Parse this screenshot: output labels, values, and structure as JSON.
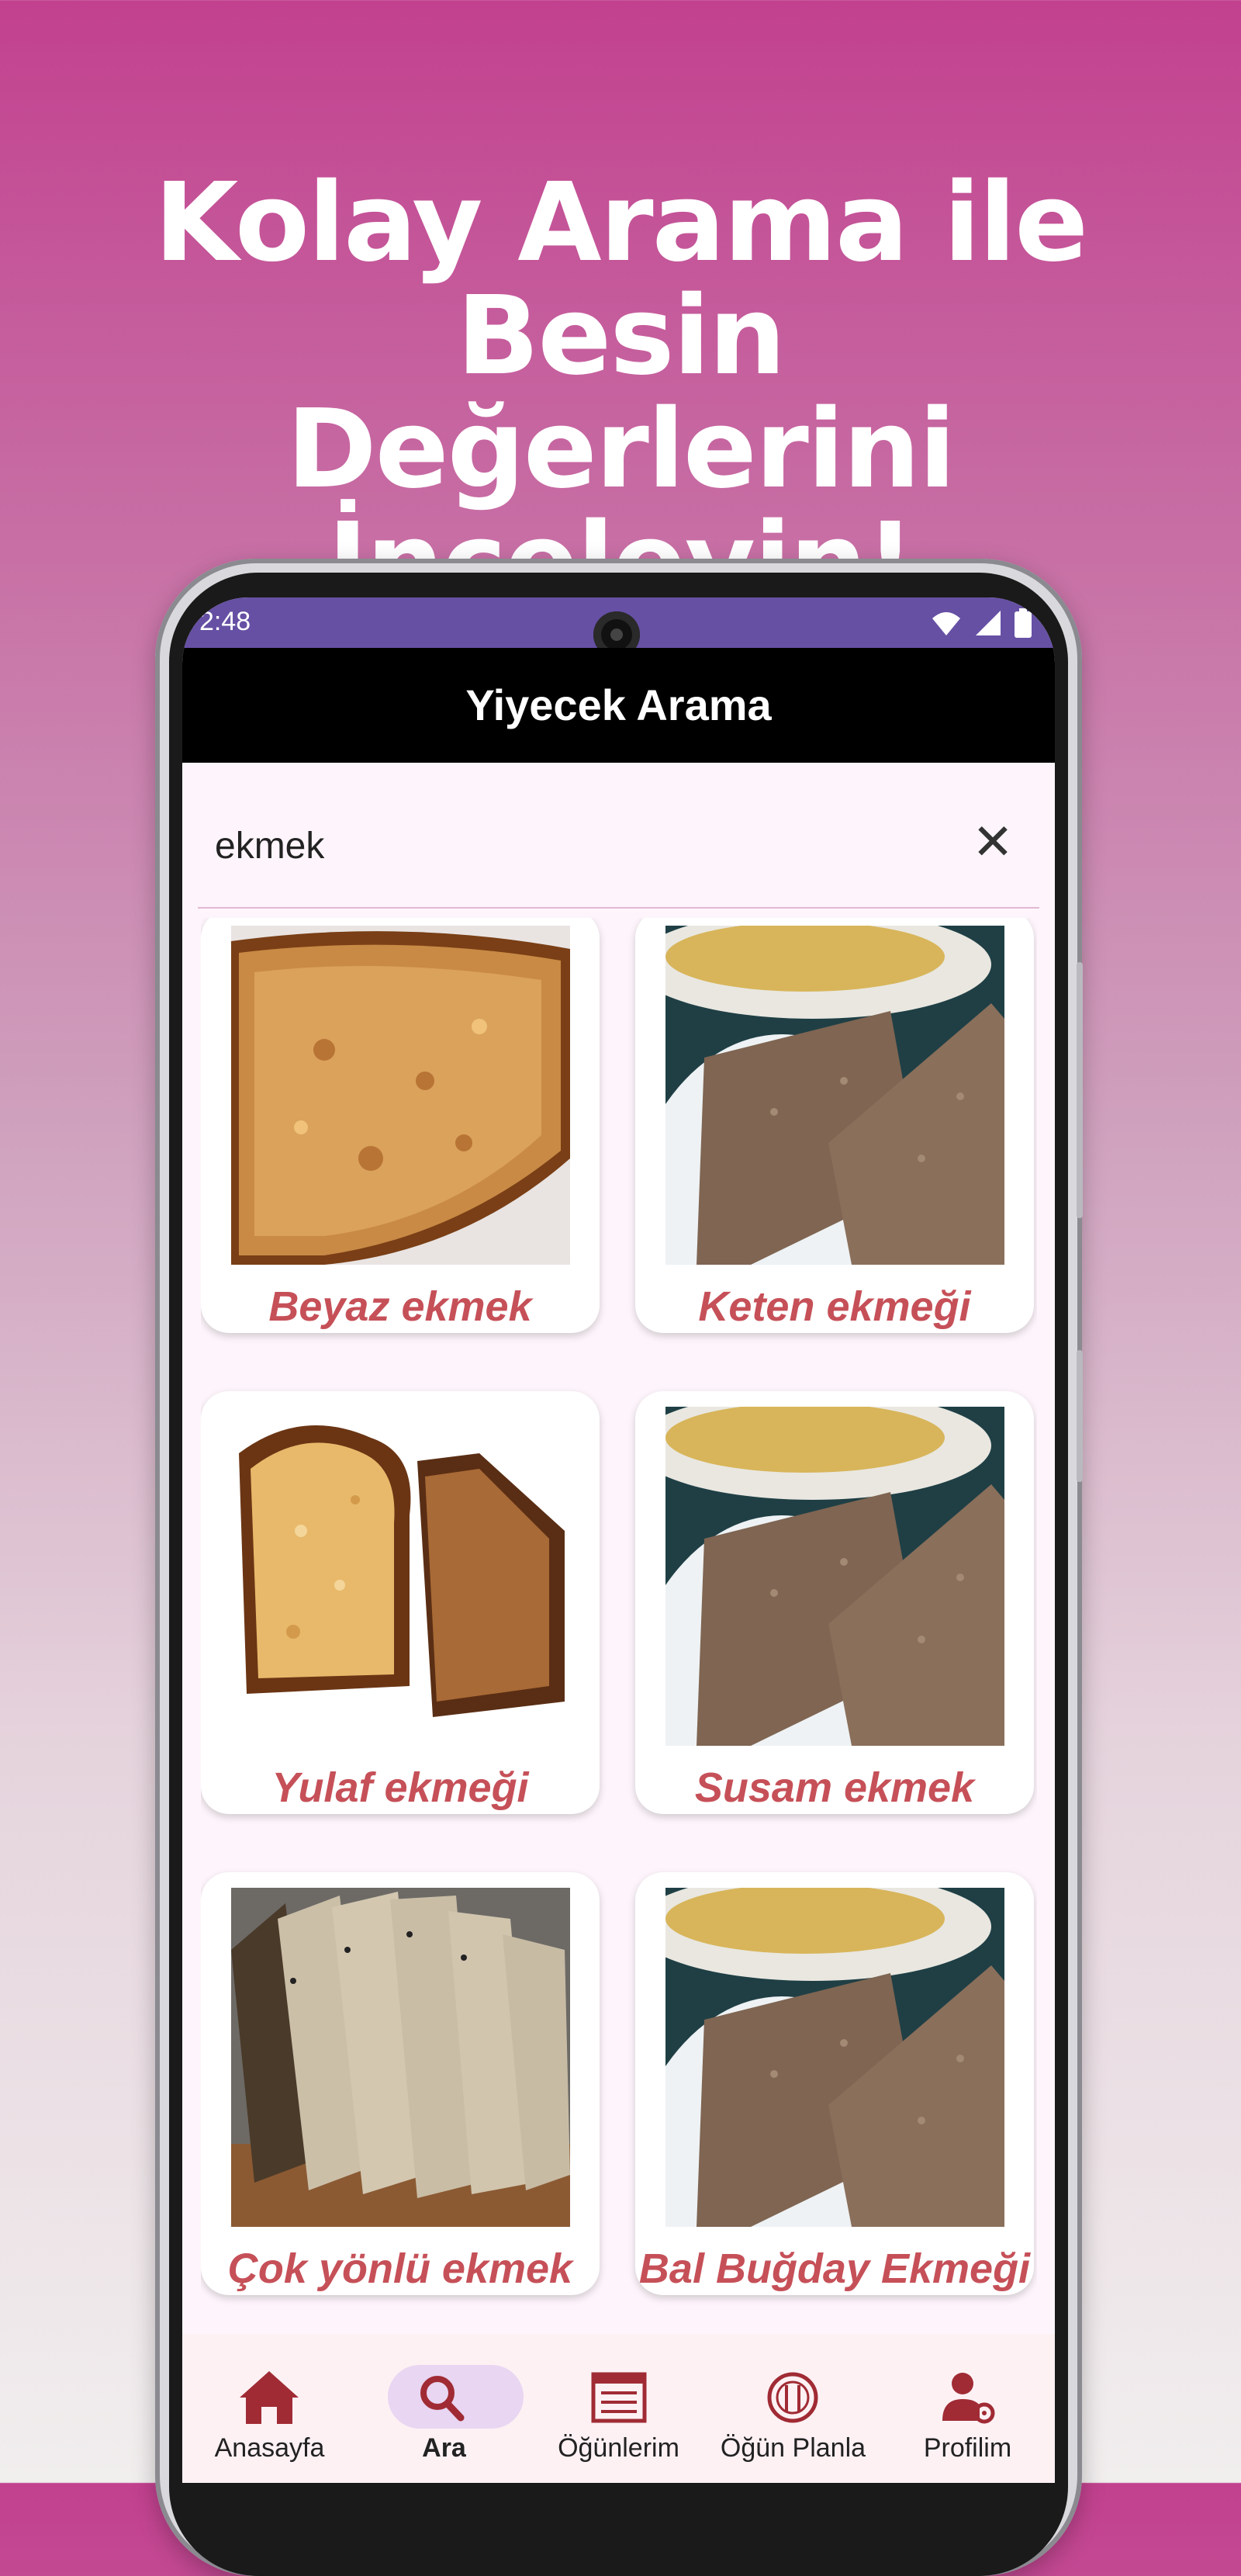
{
  "headline": {
    "line1": "Kolay Arama ile Besin",
    "line2": "Değerlerini İnceleyin!"
  },
  "status_bar": {
    "time": "2:48",
    "icons": [
      "wifi-icon",
      "signal-icon",
      "battery-icon"
    ]
  },
  "app_bar": {
    "title": "Yiyecek Arama"
  },
  "search": {
    "value": "ekmek",
    "clear_icon": "close-icon"
  },
  "results": [
    {
      "label": "Beyaz ekmek",
      "image": "toasted-bread-slice"
    },
    {
      "label": "Keten ekmeği",
      "image": "brown-toast-with-omelette"
    },
    {
      "label": "Yulaf ekmeği",
      "image": "sliced-toasted-loaf"
    },
    {
      "label": "Susam ekmek",
      "image": "brown-toast-with-omelette"
    },
    {
      "label": "Çok yönlü ekmek",
      "image": "sliced-seeded-bread"
    },
    {
      "label": "Bal Buğday Ekmeği",
      "image": "brown-toast-with-omelette"
    }
  ],
  "bottom_nav": [
    {
      "label": "Anasayfa",
      "icon": "home-icon",
      "active": false
    },
    {
      "label": "Ara",
      "icon": "search-icon",
      "active": true
    },
    {
      "label": "Öğünlerim",
      "icon": "list-icon",
      "active": false
    },
    {
      "label": "Öğün Planla",
      "icon": "plate-cutlery-icon",
      "active": false
    },
    {
      "label": "Profilim",
      "icon": "profile-settings-icon",
      "active": false
    }
  ],
  "colors": {
    "status_bar": "#6650a4",
    "label_red": "#c65058",
    "nav_icon": "#a02b34",
    "nav_active_pill": "#e8d6f2"
  }
}
